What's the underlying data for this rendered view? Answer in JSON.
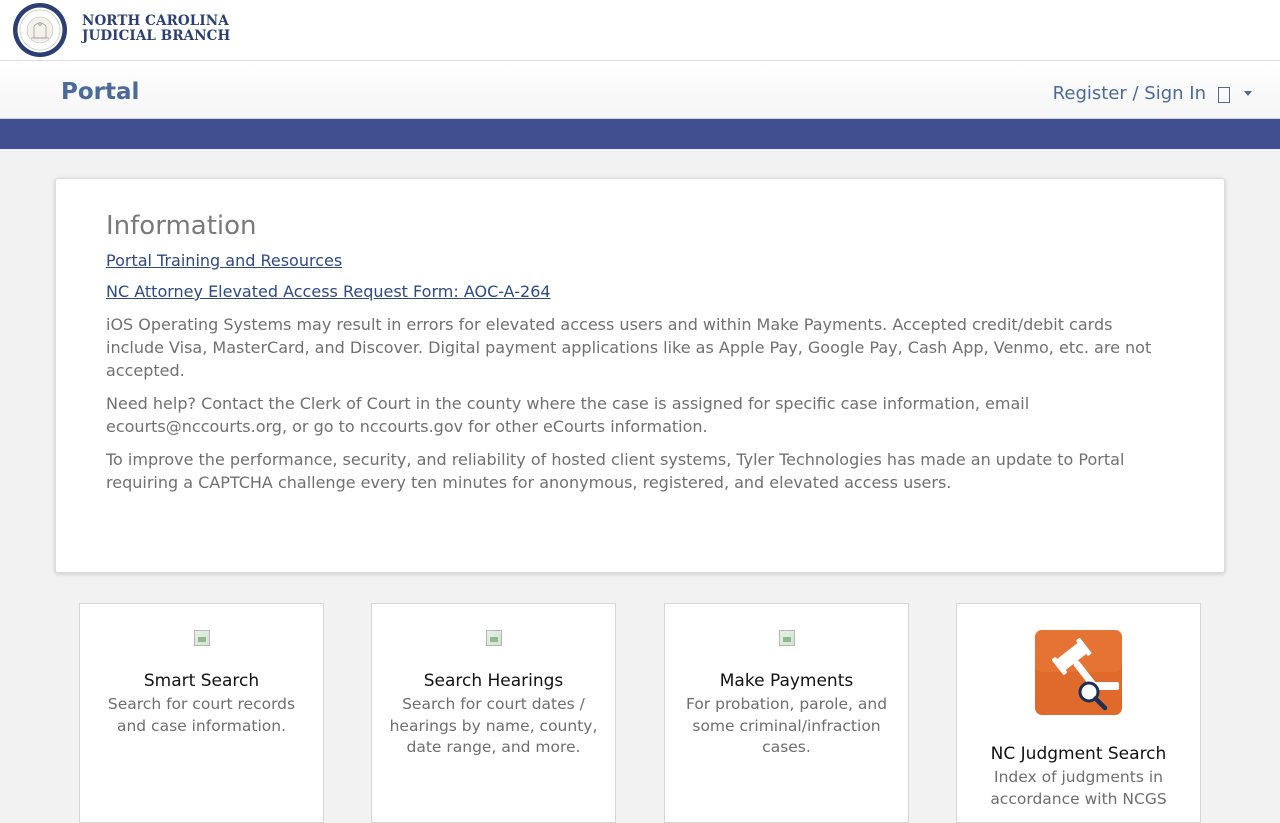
{
  "brand": {
    "line1": "NORTH CAROLINA",
    "line2": "JUDICIAL BRANCH",
    "seal_icon": "nc-judicial-seal-icon"
  },
  "nav": {
    "title": "Portal",
    "signin_label": "Register / Sign In",
    "user_icon": "user-icon",
    "caret_icon": "chevron-down-icon"
  },
  "colors": {
    "nav_text": "#4b6a98",
    "stripe": "#404f8f",
    "link": "#2e4a86",
    "judgment_icon_bg": "#e06a2c"
  },
  "info": {
    "title": "Information",
    "links": [
      "Portal Training and Resources",
      "NC Attorney Elevated Access Request Form: AOC-A-264"
    ],
    "paragraphs": [
      "iOS Operating Systems may result in errors for elevated access users and within Make Payments. Accepted credit/debit cards include Visa, MasterCard, and Discover. Digital payment applications like as Apple Pay, Google Pay, Cash App, Venmo, etc. are not accepted.",
      "Need help? Contact the Clerk of Court in the county where the case is assigned for specific case information, email ecourts@nccourts.org, or go to nccourts.gov for other eCourts information.",
      "To improve the performance, security, and reliability of hosted client systems, Tyler Technologies has made an update to Portal requiring a CAPTCHA challenge every ten minutes for anonymous, registered, and elevated access users."
    ]
  },
  "tiles": [
    {
      "title": "Smart Search",
      "desc": "Search for court records and case information."
    },
    {
      "title": "Search Hearings",
      "desc": "Search for court dates / hearings by name, county, date range, and more."
    },
    {
      "title": "Make Payments",
      "desc": "For probation, parole, and some criminal/infraction cases."
    },
    {
      "title": "NC Judgment Search",
      "desc": "Index of judgments in accordance with NCGS",
      "icon": "gavel-search-icon"
    }
  ]
}
